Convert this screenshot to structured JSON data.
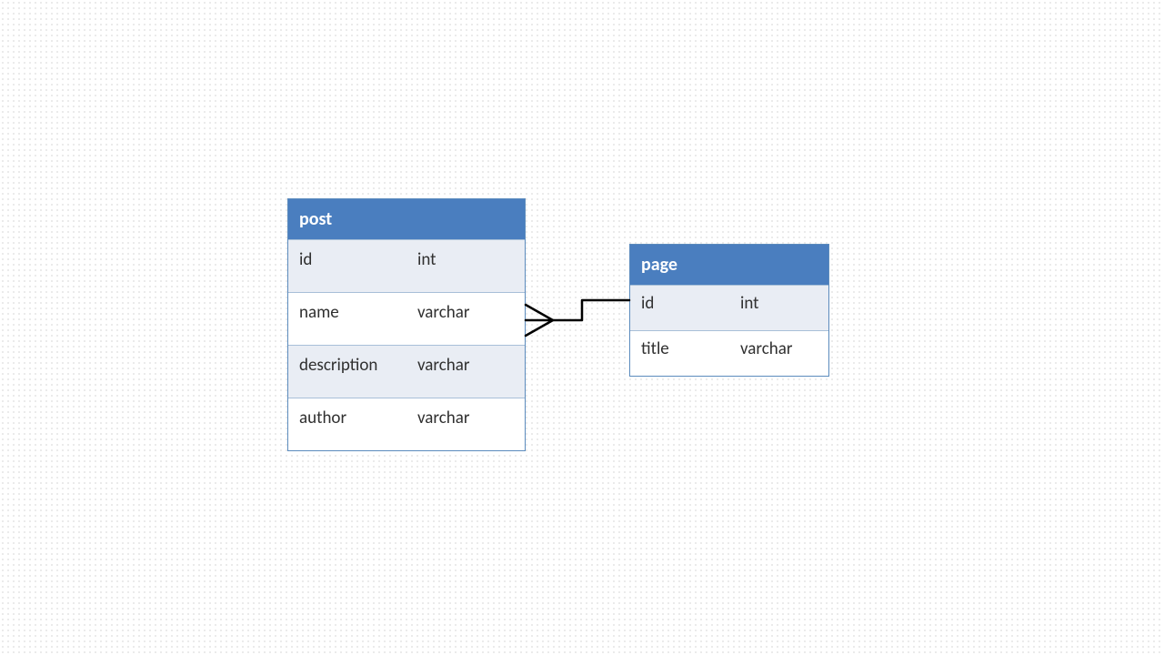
{
  "entities": {
    "post": {
      "title": "post",
      "columns": [
        {
          "name": "id",
          "type": "int"
        },
        {
          "name": "name",
          "type": "varchar"
        },
        {
          "name": "description",
          "type": "varchar"
        },
        {
          "name": "author",
          "type": "varchar"
        }
      ]
    },
    "page": {
      "title": "page",
      "columns": [
        {
          "name": "id",
          "type": "int"
        },
        {
          "name": "title",
          "type": "varchar"
        }
      ]
    }
  },
  "relationship": {
    "from": "post",
    "to": "page",
    "type": "many-to-one"
  }
}
